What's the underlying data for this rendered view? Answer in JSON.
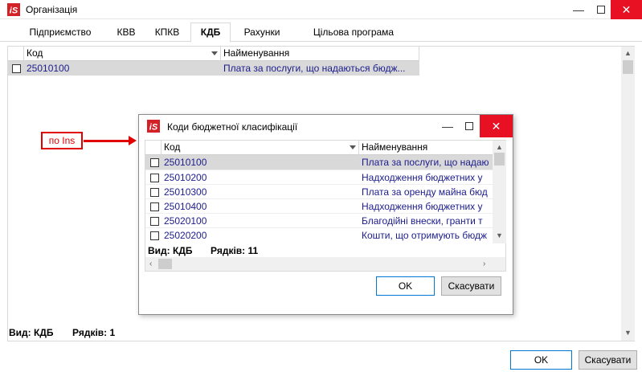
{
  "window": {
    "title": "Організація",
    "tabs": [
      {
        "label": "Підприємство"
      },
      {
        "label": "КВВ"
      },
      {
        "label": "КПКВ"
      },
      {
        "label": "КДБ",
        "active": true
      },
      {
        "label": "Рахунки"
      },
      {
        "label": "Цільова програма"
      }
    ],
    "grid": {
      "columns": [
        "Код",
        "Найменування"
      ],
      "rows": [
        {
          "code": "25010100",
          "name": "Плата за послуги, що надаються бюдж..."
        }
      ]
    },
    "status": {
      "view_label": "Вид: КДБ",
      "rows_label": "Рядків: 1"
    },
    "ok_label": "OK",
    "cancel_label": "Скасувати"
  },
  "dialog": {
    "title": "Коди бюджетної класифікації",
    "grid": {
      "columns": [
        "Код",
        "Найменування"
      ],
      "rows": [
        {
          "code": "25010100",
          "name": "Плата за послуги, що надаю"
        },
        {
          "code": "25010200",
          "name": "Надходження бюджетних у"
        },
        {
          "code": "25010300",
          "name": "Плата за оренду майна бюд"
        },
        {
          "code": "25010400",
          "name": "Надходження бюджетних у"
        },
        {
          "code": "25020100",
          "name": "Благодійні внески, гранти т"
        },
        {
          "code": "25020200",
          "name": "Кошти, що отримують бюдж"
        }
      ]
    },
    "status": {
      "view_label": "Вид: КДБ",
      "rows_label": "Рядків: 11"
    },
    "ok_label": "OK",
    "cancel_label": "Скасувати"
  },
  "annotation": {
    "label": "по Ins"
  },
  "colors": {
    "accent": "#0078d7",
    "close": "#e81123",
    "annotation": "#e00000",
    "link_text": "#1c1c8c",
    "logo": "#d42027"
  }
}
